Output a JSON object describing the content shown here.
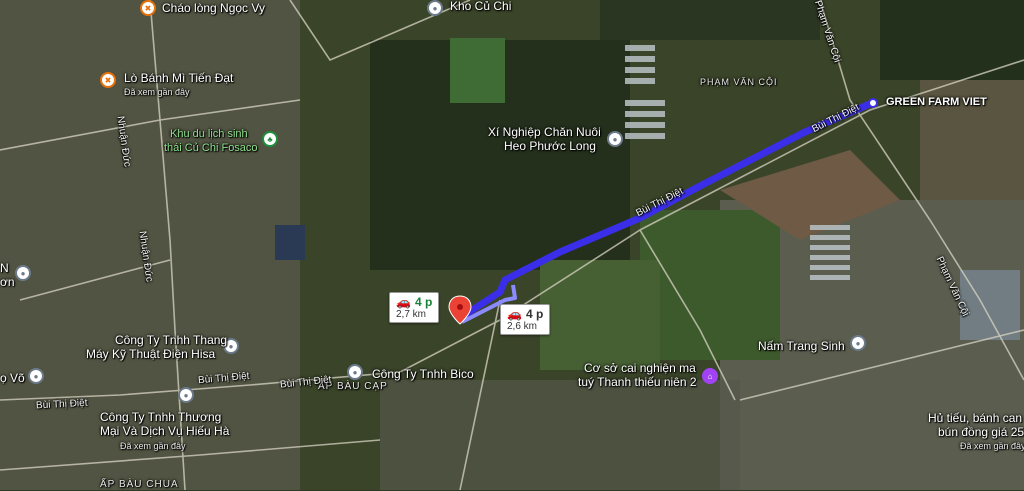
{
  "places": {
    "chao_long": "Cháo lòng Ngọc Vy",
    "kho_cu_chi": "Kho Củ Chi",
    "lo_banh_mi": "Lò Bánh Mì Tiến Đạt",
    "lo_banh_mi_sub": "Đã xem gần đây",
    "khu_du_lich_1": "Khu du lịch sinh",
    "khu_du_lich_2": "thái Củ Chi Fosaco",
    "xi_nghiep_1": "Xí Nghiệp Chăn Nuôi",
    "xi_nghiep_2": "Heo Phước Long",
    "green_farm": "GREEN FARM VIET",
    "pham_van_coi_area": "PHẠM VĂN CỘI",
    "cong_ty_thang_1": "Công Ty Tnhh Thang",
    "cong_ty_thang_2": "Máy Kỹ Thuật Điện Hisa",
    "cong_ty_bico": "Công Ty Tnhh Bico",
    "ap_bau_cap": "ẤP BÀU CẠP",
    "cong_ty_thuong_1": "Công Ty Tnhh Thương",
    "cong_ty_thuong_2": "Mại Và Dịch Vụ Hiếu Hà",
    "cong_ty_thuong_sub": "Đã xem gần đây",
    "co_so_1": "Cơ sở cai nghiện ma",
    "co_so_2": "tuý Thanh thiếu niên 2",
    "nam_trang_sinh": "Nấm Trang Sinh",
    "hu_tieu_1": "Hủ tiếu, bánh can",
    "hu_tieu_2": "bún đồng giá 25",
    "hu_tieu_sub": "Đã xem gần đây",
    "ap_bau_chua": "ẤP BÀU CHUA",
    "left_n": "N",
    "left_on": "ơn",
    "left_vo": "ọ Võ"
  },
  "roads": {
    "bui_thi_diet_1": "Bùi Thị Điệt",
    "bui_thi_diet_2": "Bùi Thị Điệt",
    "bui_thi_diet_3": "Bùi Thị Điệt",
    "bui_thi_diet_4": "Bùi Thị Điệt",
    "bui_thi_diet_5": "Bùi Thị Điệt",
    "nhuan_duc_1": "Nhuận Đức",
    "nhuan_duc_2": "Nhuận Đức",
    "pham_van_coi_1": "Phạm Văn Cội",
    "pham_van_coi_2": "Phạm Văn Cội"
  },
  "routes": {
    "primary": {
      "time": "4 p",
      "distance": "2,7 km"
    },
    "alternate": {
      "time": "4 p",
      "distance": "2,6 km"
    }
  },
  "colors": {
    "route": "#3b2ee8",
    "route_alt": "#8b8bff",
    "destination_pin": "#ea4335"
  }
}
